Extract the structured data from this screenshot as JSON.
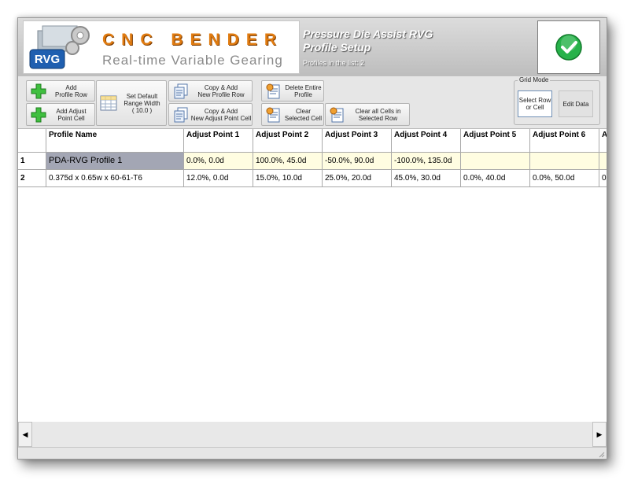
{
  "header": {
    "logo_badge": "RVG",
    "brand_title": "CNC BENDER",
    "brand_subtitle": "Real-time Variable Gearing",
    "title_line1": "Pressure Die Assist RVG",
    "title_line2": "Profile Setup",
    "profiles_count": "Profiles in the list: 2"
  },
  "toolbar": {
    "add_profile_row": "Add\nProfile Row",
    "add_adjust_point_cell": "Add Adjust\nPoint Cell",
    "set_default_range": "Set Default\nRange Width\n( 10.0 )",
    "copy_add_profile_row": "Copy & Add\nNew Profile Row",
    "copy_add_adjust_cell": "Copy & Add\nNew Adjust Point Cell",
    "delete_profile": "Delete Entire\nProfile",
    "clear_selected_cell": "Clear\nSelected Cell",
    "clear_all_cells": "Clear all Cells in\nSelected Row",
    "grid_mode_legend": "Grid Mode",
    "select_row_or_cell": "Select Row\nor Cell",
    "edit_data": "Edit Data"
  },
  "grid": {
    "columns": [
      "Profile Name",
      "Adjust Point 1",
      "Adjust Point 2",
      "Adjust Point 3",
      "Adjust Point 4",
      "Adjust Point 5",
      "Adjust Point 6",
      "A"
    ],
    "rows": [
      {
        "num": "1",
        "name": "PDA-RVG Profile 1",
        "cells": [
          "0.0%, 0.0d",
          "100.0%, 45.0d",
          "-50.0%, 90.0d",
          "-100.0%, 135.0d",
          "",
          "",
          ""
        ]
      },
      {
        "num": "2",
        "name": "0.375d x 0.65w x 60-61-T6",
        "cells": [
          "12.0%, 0.0d",
          "15.0%, 10.0d",
          "25.0%, 20.0d",
          "45.0%, 30.0d",
          "0.0%, 40.0d",
          "0.0%, 50.0d",
          "0"
        ]
      }
    ]
  },
  "colors": {
    "brand_orange": "#e07b10",
    "row_highlight": "#fffde1",
    "selected_cell": "#a3a6b4",
    "ok_green": "#27b24a"
  },
  "icons": {
    "ok": "checkmark-icon",
    "add": "green-plus-icon",
    "range": "spreadsheet-icon",
    "copy": "document-copy-icon",
    "delete": "profile-delete-icon",
    "clear": "clear-cell-icon",
    "scroll_left": "arrow-left-icon",
    "scroll_right": "arrow-right-icon"
  }
}
